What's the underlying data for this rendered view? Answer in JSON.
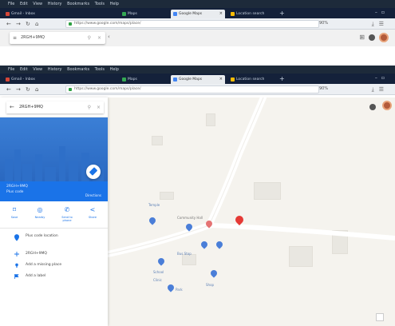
{
  "back_window": {
    "menu_items": [
      "File",
      "Edit",
      "View",
      "History",
      "Bookmarks",
      "Tools",
      "Help"
    ],
    "tabs": [
      {
        "label": "Gmail - Inbox",
        "fav": "#d44638"
      },
      {
        "label": "Maps",
        "fav": "#34a853"
      },
      {
        "label": "Google Maps",
        "fav": "#4285f4",
        "active": true
      },
      {
        "label": "Location search",
        "fav": "#fbbc05"
      }
    ],
    "url": "https://www.google.com/maps/place/",
    "zoom": "90%",
    "search_value": "2RGH+9MQ"
  },
  "front_window": {
    "menu_items": [
      "File",
      "Edit",
      "View",
      "History",
      "Bookmarks",
      "Tools",
      "Help"
    ],
    "tabs": [
      {
        "label": "Gmail - Inbox",
        "fav": "#d44638"
      },
      {
        "label": "Maps",
        "fav": "#34a853"
      },
      {
        "label": "Google Maps",
        "fav": "#4285f4",
        "active": true
      },
      {
        "label": "Location search",
        "fav": "#fbbc05"
      }
    ],
    "url": "https://www.google.com/maps/place/",
    "zoom": "90%"
  },
  "sidebar": {
    "search_value": "2RGH+9MQ",
    "place_title": "2RGH+9MQ",
    "place_subtitle": "Plus code",
    "directions_label": "Directions",
    "actions": [
      {
        "icon": "save-icon",
        "glyph": "⌑",
        "label": "Save"
      },
      {
        "icon": "nearby-icon",
        "glyph": "◎",
        "label": "Nearby"
      },
      {
        "icon": "phone-icon",
        "glyph": "✆",
        "label": "Send to phone"
      },
      {
        "icon": "share-icon",
        "glyph": "<",
        "label": "Share"
      }
    ],
    "details": [
      {
        "icon": "location-pin-icon",
        "text": "Plus code location",
        "color": "#1a73e8"
      },
      {
        "icon": "plus-code-icon",
        "text": "2RGH+9MQ",
        "color": "#1a73e8"
      },
      {
        "icon": "add-place-icon",
        "text": "Add a missing place",
        "color": "#1a73e8"
      },
      {
        "icon": "label-flag-icon",
        "text": "Add a label",
        "color": "#1a73e8"
      }
    ]
  },
  "map": {
    "labels": [
      "Temple",
      "Community Hall",
      "Bus Stop",
      "School",
      "Shop",
      "Park",
      "Clinic"
    ]
  },
  "colors": {
    "accent": "#1a73e8",
    "titlebar": "#14213a",
    "marker_red": "#e53935"
  }
}
